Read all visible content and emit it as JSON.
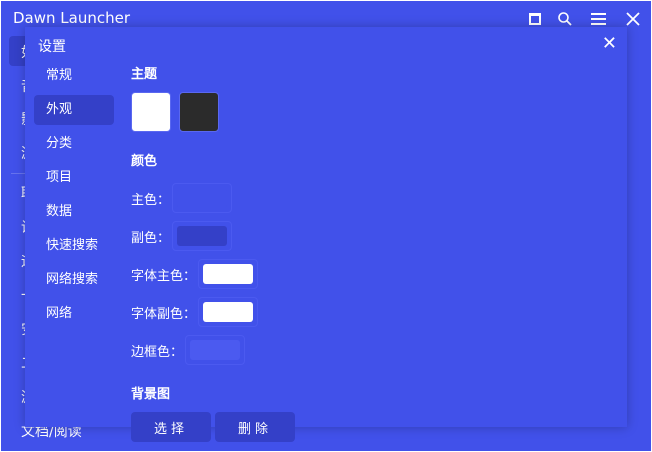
{
  "app": {
    "title": "Dawn Launcher"
  },
  "titlebar": {
    "icons": [
      "window-icon",
      "search-icon",
      "menu-icon",
      "close-icon"
    ]
  },
  "background_sidebar": {
    "items": [
      "如",
      "音",
      "影",
      "游",
      "联",
      "设",
      "运",
      "一",
      "安",
      "二",
      "游"
    ],
    "bottom_item": "文档/阅读"
  },
  "dialog": {
    "title": "设置",
    "close": "✕",
    "nav": [
      {
        "label": "常规"
      },
      {
        "label": "外观",
        "selected": true
      },
      {
        "label": "分类"
      },
      {
        "label": "项目"
      },
      {
        "label": "数据"
      },
      {
        "label": "快速搜索"
      },
      {
        "label": "网络搜索"
      },
      {
        "label": "网络"
      }
    ],
    "theme_heading": "主题",
    "themes": [
      {
        "color": "#ffffff"
      },
      {
        "color": "#2b2b2b"
      }
    ],
    "color_heading": "颜色",
    "colors": [
      {
        "label": "主色：",
        "value": "#4151ea"
      },
      {
        "label": "副色：",
        "value": "#3440c8"
      },
      {
        "label": "字体主色：",
        "value": "#ffffff"
      },
      {
        "label": "字体副色：",
        "value": "#ffffff"
      },
      {
        "label": "边框色：",
        "value": "#4b5af0"
      }
    ],
    "bg_heading": "背景图",
    "select_label": "选择",
    "delete_label": "删除"
  }
}
